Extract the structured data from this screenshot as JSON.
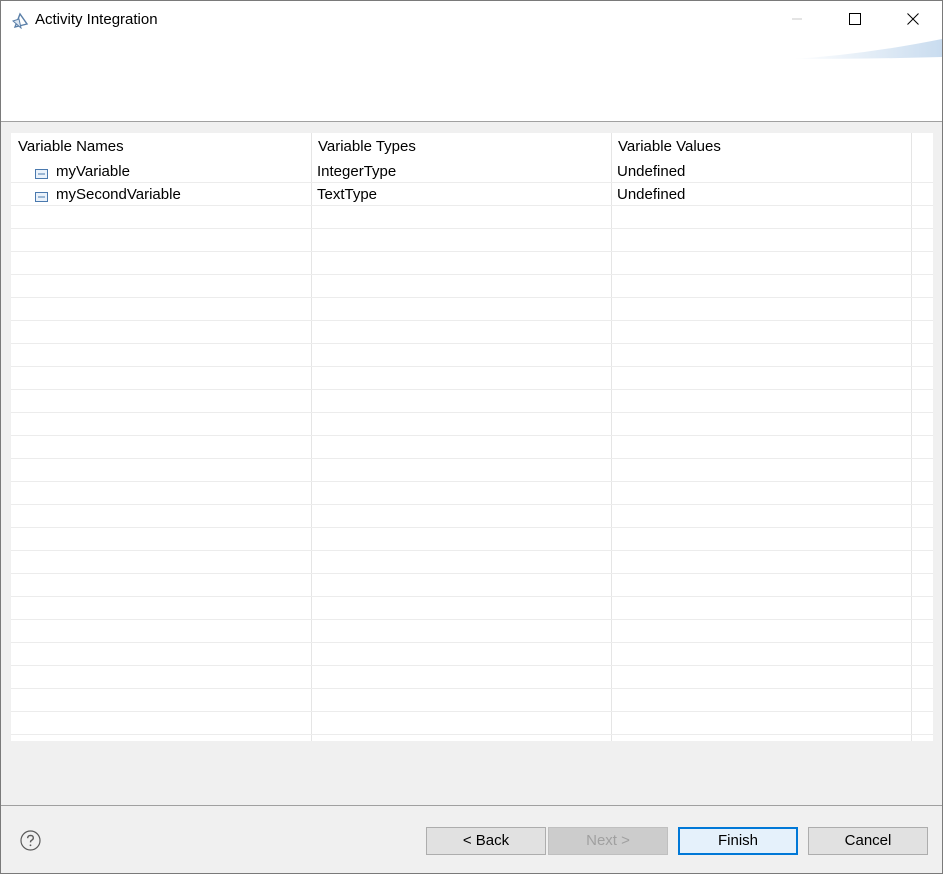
{
  "window": {
    "title": "Activity Integration",
    "app_icon": "wizard-app-icon",
    "controls": [
      "minimize-icon",
      "maximize-icon",
      "close-icon"
    ]
  },
  "table": {
    "columns": [
      "Variable Names",
      "Variable Types",
      "Variable Values"
    ],
    "rows": [
      {
        "name": "myVariable",
        "type": "IntegerType",
        "value": "Undefined",
        "icon": "variable-icon"
      },
      {
        "name": "mySecondVariable",
        "type": "TextType",
        "value": "Undefined",
        "icon": "variable-icon"
      }
    ]
  },
  "footer": {
    "help_icon": "help-icon",
    "back_label": "< Back",
    "next_label": "Next >",
    "finish_label": "Finish",
    "cancel_label": "Cancel"
  },
  "colors": {
    "accent": "#0078d7",
    "background": "#f0f0f0",
    "grid_line": "#ececec"
  }
}
